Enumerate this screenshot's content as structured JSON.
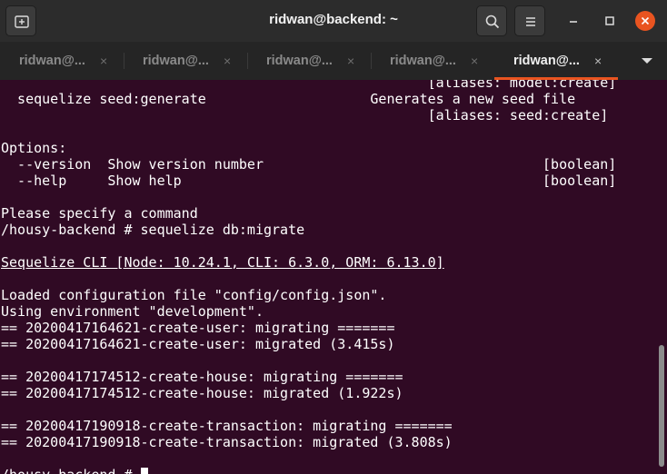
{
  "window": {
    "title": "ridwan@backend: ~"
  },
  "header": {
    "new_tab_icon": "new-tab-icon",
    "search_icon": "search-icon",
    "menu_icon": "hamburger-menu-icon",
    "minimize_icon": "minimize-icon",
    "maximize_icon": "maximize-icon",
    "close_icon": "close-icon",
    "accent_color": "#e95420"
  },
  "tabs": [
    {
      "label": "ridwan@...",
      "close": "×",
      "active": false
    },
    {
      "label": "ridwan@...",
      "close": "×",
      "active": false
    },
    {
      "label": "ridwan@...",
      "close": "×",
      "active": false
    },
    {
      "label": "ridwan@...",
      "close": "×",
      "active": false
    },
    {
      "label": "ridwan@...",
      "close": "×",
      "active": true
    }
  ],
  "terminal": {
    "background": "#300a24",
    "lines": [
      "                                                    [aliases: model:create]",
      "  sequelize seed:generate                    Generates a new seed file",
      "                                                    [aliases: seed:create]",
      "",
      "Options:",
      "  --version  Show version number                                  [boolean]",
      "  --help     Show help                                            [boolean]",
      "",
      "Please specify a command",
      "/housy-backend # sequelize db:migrate",
      "",
      "Sequelize CLI [Node: 10.24.1, CLI: 6.3.0, ORM: 6.13.0]",
      "",
      "Loaded configuration file \"config/config.json\".",
      "Using environment \"development\".",
      "== 20200417164621-create-user: migrating =======",
      "== 20200417164621-create-user: migrated (3.415s)",
      "",
      "== 20200417174512-create-house: migrating =======",
      "== 20200417174512-create-house: migrated (1.922s)",
      "",
      "== 20200417190918-create-transaction: migrating =======",
      "== 20200417190918-create-transaction: migrated (3.808s)",
      "",
      "/housy-backend # "
    ]
  }
}
